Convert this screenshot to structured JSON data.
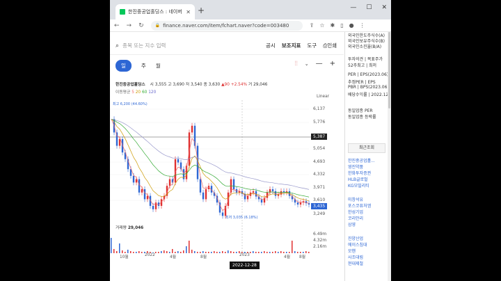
{
  "browser": {
    "tab_title": "한진중공업홀딩스 : 네이버 증권",
    "url": "finance.naver.com/item/fchart.naver?code=003480",
    "new_tab": "+",
    "win_controls": [
      "—",
      "☐",
      "✕"
    ]
  },
  "page": {
    "search_placeholder": "종목 또는 지수 입력",
    "menu": [
      "공시",
      "보조지표",
      "도구",
      "인쇄"
    ],
    "periods": [
      "일",
      "주",
      "월"
    ],
    "stock": {
      "name": "한진중공업홀딩스",
      "open_label": "시",
      "open": "3,555",
      "high_label": "고",
      "high": "3,690",
      "low_label": "저",
      "low": "3,540",
      "close_label": "종",
      "close": "3,630",
      "change": "▲90",
      "change_pct": "+2.54%",
      "volume_label": "거",
      "volume": "29,046"
    },
    "ma": {
      "label": "이동평균",
      "m5": "5",
      "m20": "20",
      "m60": "60",
      "m120": "120"
    },
    "scale": "Linear",
    "price_ticks": [
      "6,137",
      "5,776",
      "5,387",
      "5,054",
      "4,693",
      "4,332",
      "3,971",
      "3,610",
      "3,435",
      "3,249"
    ],
    "high_note": "최고 6,200 (44.60%)",
    "low_note": "최저 3,035 (6.18%)",
    "volume_header": "거래량",
    "volume_value": "29,046",
    "volume_ticks": [
      "6.49m",
      "4.32m",
      "2.16m"
    ],
    "x_labels": [
      "10월",
      "2022",
      "4월",
      "8월",
      "2023",
      "4월",
      "8월"
    ],
    "crosshair_date": "2022-12-28"
  },
  "sidebar": {
    "top": [
      "외국인한도주식수(A)",
      "외국인보유주식수(B)",
      "외국인소진율(B/A)"
    ],
    "info": [
      "투자의견 | 목표주가",
      "52주최고 | 최저"
    ],
    "per": [
      "PER | EPS(2023.06)",
      "추정PER | EPS",
      "PBR | BPS(2023.06)",
      "배당수익률 | 2022.12"
    ],
    "sector": [
      "동일업종 PER",
      "동일업종 등락률"
    ],
    "recent_title": "최근조회",
    "recent": [
      "한진중공업홀...",
      "영진약품",
      "한화투자증권",
      "HLB글로벌",
      "KG모빌리티"
    ],
    "list2": [
      "미창석유",
      "포스코퓨처엠",
      "한성기업",
      "코리안리",
      "삼영"
    ],
    "list3": [
      "진양산업",
      "에이스침대",
      "모헨",
      "사조대림",
      "현대제철"
    ]
  },
  "colors": {
    "accent": "#2d66d4",
    "up": "#e03030",
    "down": "#2d66d4"
  }
}
